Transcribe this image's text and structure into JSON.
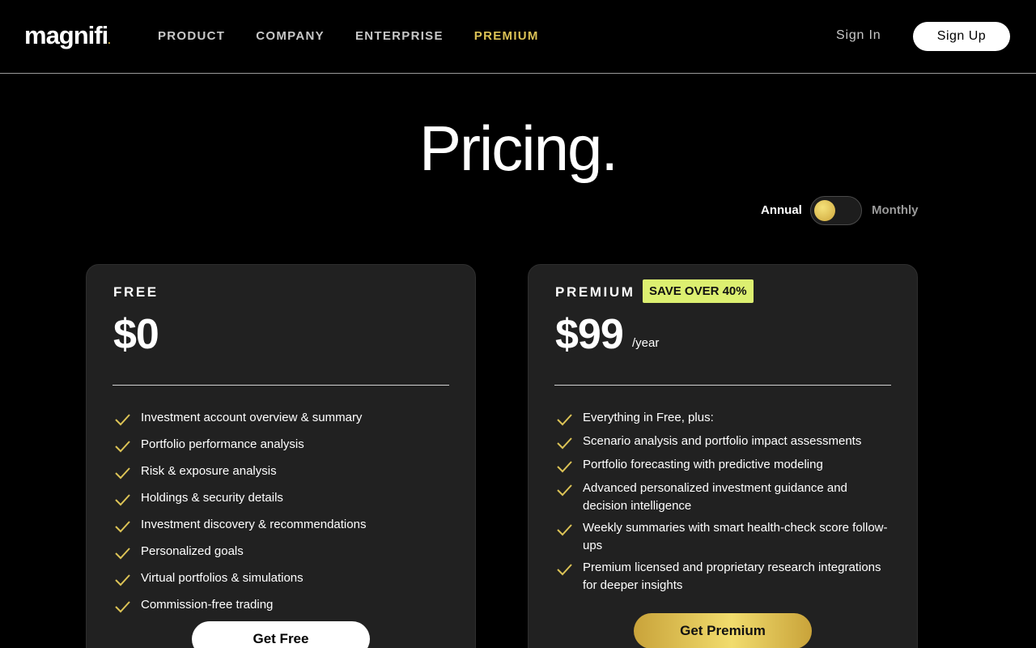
{
  "header": {
    "logo": "magnifi",
    "logo_dot": ".",
    "nav": [
      {
        "label": "PRODUCT"
      },
      {
        "label": "COMPANY"
      },
      {
        "label": "ENTERPRISE"
      },
      {
        "label": "PREMIUM"
      }
    ],
    "sign_in": "Sign In",
    "sign_up": "Sign Up"
  },
  "page": {
    "title": "Pricing."
  },
  "billing": {
    "annual_label": "Annual",
    "monthly_label": "Monthly",
    "selected": "Annual"
  },
  "plans": {
    "free": {
      "name": "FREE",
      "price": "$0",
      "features": [
        "Investment account overview & summary",
        "Portfolio performance analysis",
        "Risk & exposure analysis",
        "Holdings & security details",
        "Investment discovery & recommendations",
        "Personalized goals",
        "Virtual portfolios & simulations",
        "Commission-free trading"
      ],
      "cta": "Get Free"
    },
    "premium": {
      "name": "PREMIUM",
      "badge": "SAVE OVER 40%",
      "price": "$99",
      "period": "/year",
      "features": [
        "Everything in Free, plus:",
        "Scenario analysis and portfolio impact assessments",
        "Portfolio forecasting with predictive modeling",
        "Advanced personalized investment guidance and decision intelligence",
        "Weekly summaries with smart health-check score follow-ups",
        "Premium licensed and proprietary research integrations for deeper insights"
      ],
      "cta": "Get Premium"
    }
  },
  "colors": {
    "accent_gold": "#dcc356",
    "badge_lime": "#dcef70",
    "card_bg": "#212121"
  }
}
